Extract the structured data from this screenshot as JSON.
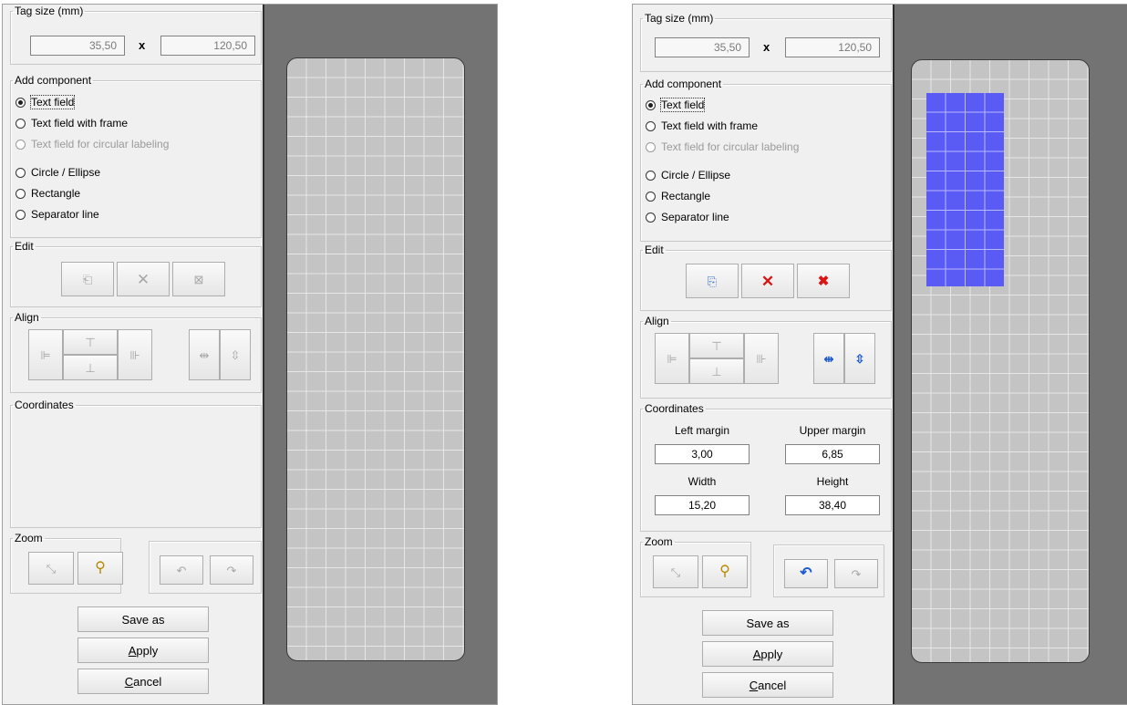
{
  "left": {
    "tag_size": {
      "legend": "Tag size (mm)",
      "width": "35,50",
      "x": "x",
      "height": "120,50"
    },
    "add_component": {
      "legend": "Add component",
      "options": [
        {
          "label": "Text field",
          "selected": true,
          "enabled": true
        },
        {
          "label": "Text field with frame",
          "selected": false,
          "enabled": true
        },
        {
          "label": "Text field for circular labeling",
          "selected": false,
          "enabled": false
        },
        {
          "label": "Circle  / Ellipse",
          "selected": false,
          "enabled": true
        },
        {
          "label": "Rectangle",
          "selected": false,
          "enabled": true
        },
        {
          "label": "Separator line",
          "selected": false,
          "enabled": true
        }
      ]
    },
    "edit": {
      "legend": "Edit"
    },
    "align": {
      "legend": "Align"
    },
    "coordinates": {
      "legend": "Coordinates"
    },
    "zoom": {
      "legend": "Zoom"
    },
    "buttons": {
      "save_as": "Save as",
      "apply_rest": "pply",
      "apply_key": "A",
      "cancel_rest": "ancel",
      "cancel_key": "C"
    }
  },
  "right": {
    "tag_size": {
      "legend": "Tag size (mm)",
      "width": "35,50",
      "x": "x",
      "height": "120,50"
    },
    "add_component": {
      "legend": "Add component",
      "options": [
        {
          "label": "Text field",
          "selected": true,
          "enabled": true
        },
        {
          "label": "Text field with frame",
          "selected": false,
          "enabled": true
        },
        {
          "label": "Text field for circular labeling",
          "selected": false,
          "enabled": false
        },
        {
          "label": "Circle  / Ellipse",
          "selected": false,
          "enabled": true
        },
        {
          "label": "Rectangle",
          "selected": false,
          "enabled": true
        },
        {
          "label": "Separator line",
          "selected": false,
          "enabled": true
        }
      ]
    },
    "edit": {
      "legend": "Edit"
    },
    "align": {
      "legend": "Align"
    },
    "coordinates": {
      "legend": "Coordinates",
      "left_margin_label": "Left margin",
      "left_margin": "3,00",
      "upper_margin_label": "Upper margin",
      "upper_margin": "6,85",
      "width_label": "Width",
      "width": "15,20",
      "height_label": "Height",
      "height": "38,40"
    },
    "zoom": {
      "legend": "Zoom"
    },
    "buttons": {
      "save_as": "Save as",
      "apply_rest": "pply",
      "apply_key": "A",
      "cancel_rest": "ancel",
      "cancel_key": "C"
    }
  },
  "icons": {
    "copy": "copy-icon",
    "delete": "delete-icon",
    "delete_all": "delete-all-icon",
    "align_left": "align-left-icon",
    "align_top": "align-top-icon",
    "align_bottom": "align-bottom-icon",
    "align_right": "align-right-icon",
    "center_h": "center-horizontal-icon",
    "center_v": "center-vertical-icon",
    "zoom_fit": "zoom-fit-icon",
    "zoom": "magnifier-icon",
    "undo": "undo-icon",
    "redo": "redo-icon"
  },
  "colors": {
    "selection": "#5a5af5",
    "canvas_bg": "#737373",
    "tag_bg": "#c4c4c4",
    "delete_red": "#d91515"
  }
}
